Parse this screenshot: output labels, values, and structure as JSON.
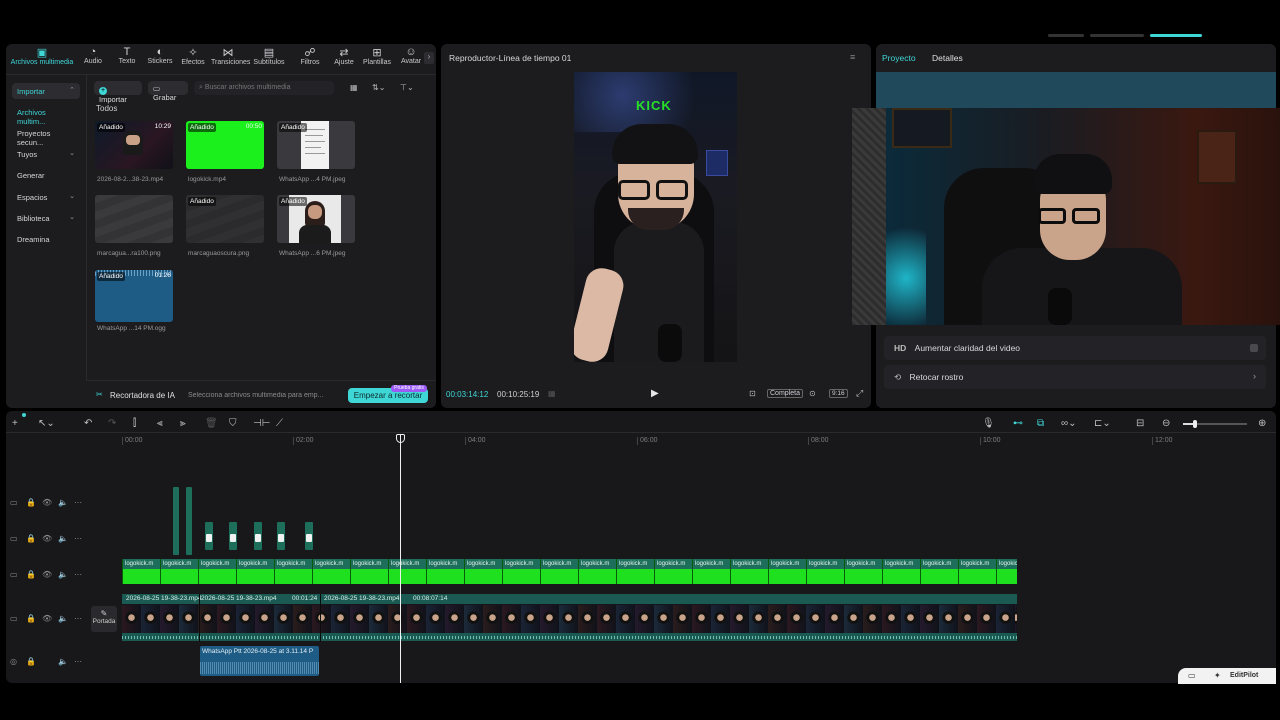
{
  "toolbar": {
    "tabs": [
      {
        "label": "Archivos multimedia",
        "icon": "media-icon",
        "active": true
      },
      {
        "label": "Audio",
        "icon": "audio-icon"
      },
      {
        "label": "Texto",
        "icon": "text-icon"
      },
      {
        "label": "Stickers",
        "icon": "sticker-icon"
      },
      {
        "label": "Efectos",
        "icon": "effects-icon"
      },
      {
        "label": "Transiciones",
        "icon": "transitions-icon"
      },
      {
        "label": "Subtítulos",
        "icon": "subtitles-icon"
      },
      {
        "label": "Filtros",
        "icon": "filters-icon"
      },
      {
        "label": "Ajuste",
        "icon": "adjust-icon"
      },
      {
        "label": "Plantillas",
        "icon": "templates-icon"
      },
      {
        "label": "Avatar",
        "icon": "avatar-icon"
      }
    ]
  },
  "sidebar": {
    "items": [
      {
        "label": "Importar",
        "chevron": "⌃",
        "selected": true
      },
      {
        "label": "Archivos multim..."
      },
      {
        "label": "Proyectos secun..."
      },
      {
        "label": "Tuyos",
        "chevron": "⌄"
      },
      {
        "label": "Generar"
      },
      {
        "label": "Espacios",
        "chevron": "⌄"
      },
      {
        "label": "Biblioteca",
        "chevron": "⌄"
      },
      {
        "label": "Dreamina"
      }
    ]
  },
  "media": {
    "import_label": "Importar",
    "record_label": "Grabar",
    "search_placeholder": "Buscar archivos multimedia",
    "filter_label": "Todos",
    "items": [
      {
        "caption": "2026-08-2...38-23.mp4",
        "badge": "Añadido",
        "duration": "10:29"
      },
      {
        "caption": "logokick.mp4",
        "badge": "Añadido",
        "duration": "00:50"
      },
      {
        "caption": "WhatsApp ...4 PM.jpeg",
        "badge": "Añadido",
        "duration": ""
      },
      {
        "caption": "marcagua...ra100.png",
        "badge": "",
        "duration": ""
      },
      {
        "caption": "marcaguaoscura.png",
        "badge": "Añadido",
        "duration": ""
      },
      {
        "caption": "WhatsApp ...6 PM.jpeg",
        "badge": "Añadido",
        "duration": ""
      },
      {
        "caption": "WhatsApp ...14 PM.ogg",
        "badge": "Añadido",
        "duration": "01:26"
      }
    ],
    "ai_cutter_label": "Recortadora de IA",
    "ai_hint": "Selecciona archivos multimedia para emp...",
    "start_cut_label": "Empezar a recortar",
    "trial_badge": "Prueba gratis"
  },
  "player": {
    "title": "Reproductor-Línea de tiempo 01",
    "current_time": "00:03:14:12",
    "total_time": "00:10:25:19",
    "quality_label": "Completa",
    "ratio_label": "9:16",
    "overlay_text": "KICK"
  },
  "right_panel": {
    "tab_project": "Proyecto",
    "tab_details": "Detalles",
    "rows": [
      {
        "prefix": "HD",
        "label": "Aumentar claridad del video"
      },
      {
        "prefix": "⟲",
        "label": "Retocar rostro"
      }
    ]
  },
  "timeline": {
    "ruler": [
      "00:00",
      "02:00",
      "04:00",
      "06:00",
      "08:00",
      "10:00",
      "12:00"
    ],
    "green_clip_label": "logokick.m",
    "video_segments": [
      {
        "label": "2026-08-25 19-38-23.mp4"
      },
      {
        "label": "2026-08-25 19-38-23.mp4",
        "time": "00:01:24"
      },
      {
        "label": "2026-08-25 19-38-23.mp4",
        "time": "00:08:07:14"
      }
    ],
    "audio_label": "WhatsApp Ptt 2026-08-25 at 3.11.14 P",
    "cover_label": "Portada"
  },
  "bottom_right": {
    "label": "EditPilot"
  },
  "colors": {
    "accent": "#3fd6d6",
    "green_screen": "#1fe01f",
    "clip_teal": "#1d6e5a",
    "panel_bg": "#1c1c1f"
  }
}
